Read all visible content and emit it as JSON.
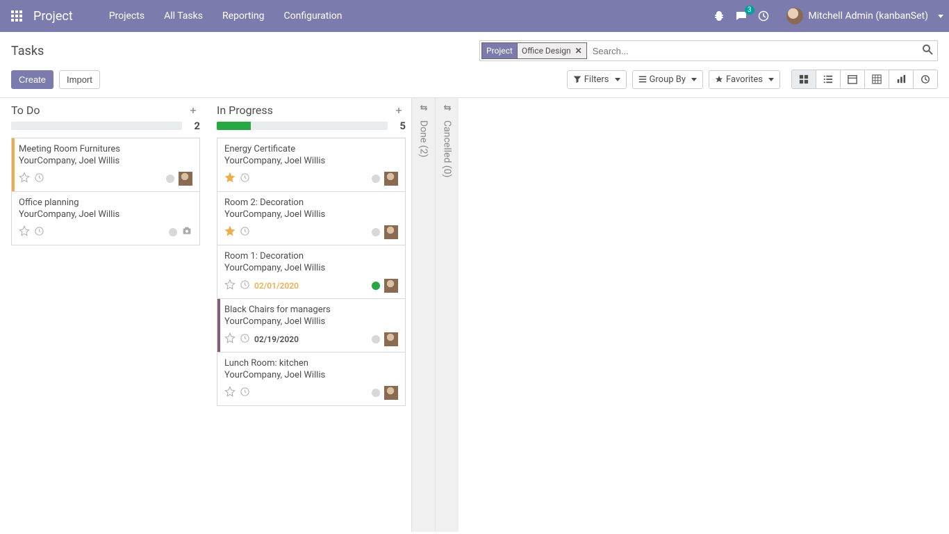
{
  "navbar": {
    "brand": "Project",
    "menu": [
      "Projects",
      "All Tasks",
      "Reporting",
      "Configuration"
    ],
    "msg_count": "3",
    "user": "Mitchell Admin (kanbanSet)"
  },
  "breadcrumb": {
    "title": "Tasks"
  },
  "search": {
    "facet_label": "Project",
    "facet_value": "Office Design",
    "placeholder": "Search..."
  },
  "buttons": {
    "create": "Create",
    "import": "Import"
  },
  "filters": {
    "filters": "Filters",
    "group_by": "Group By",
    "favorites": "Favorites"
  },
  "columns": [
    {
      "title": "To Do",
      "count": "2",
      "progress_pct": 0,
      "cards": [
        {
          "title": "Meeting Room Furnitures",
          "sub": "YourCompany, Joel Willis",
          "star": false,
          "date": "",
          "date_state": "",
          "dot": "grey",
          "stripe": "#f0ad4e",
          "avatar": true,
          "camera": false
        },
        {
          "title": "Office planning",
          "sub": "YourCompany, Joel Willis",
          "star": false,
          "date": "",
          "date_state": "",
          "dot": "grey",
          "stripe": "",
          "avatar": false,
          "camera": true
        }
      ]
    },
    {
      "title": "In Progress",
      "count": "5",
      "progress_pct": 20,
      "cards": [
        {
          "title": "Energy Certificate",
          "sub": "YourCompany, Joel Willis",
          "star": true,
          "date": "",
          "date_state": "",
          "dot": "grey",
          "stripe": "",
          "avatar": true,
          "camera": false
        },
        {
          "title": "Room 2: Decoration",
          "sub": "YourCompany, Joel Willis",
          "star": true,
          "date": "",
          "date_state": "",
          "dot": "grey",
          "stripe": "",
          "avatar": true,
          "camera": false
        },
        {
          "title": "Room 1: Decoration",
          "sub": "YourCompany, Joel Willis",
          "star": false,
          "date": "02/01/2020",
          "date_state": "overdue",
          "dot": "green",
          "stripe": "",
          "avatar": true,
          "camera": false
        },
        {
          "title": "Black Chairs for managers",
          "sub": "YourCompany, Joel Willis",
          "star": false,
          "date": "02/19/2020",
          "date_state": "normal",
          "dot": "grey",
          "stripe": "#875a7b",
          "avatar": true,
          "camera": false
        },
        {
          "title": "Lunch Room: kitchen",
          "sub": "YourCompany, Joel Willis",
          "star": false,
          "date": "",
          "date_state": "",
          "dot": "grey",
          "stripe": "",
          "avatar": true,
          "camera": false
        }
      ]
    }
  ],
  "folded": [
    {
      "label": "Done (2)"
    },
    {
      "label": "Cancelled (0)"
    }
  ]
}
